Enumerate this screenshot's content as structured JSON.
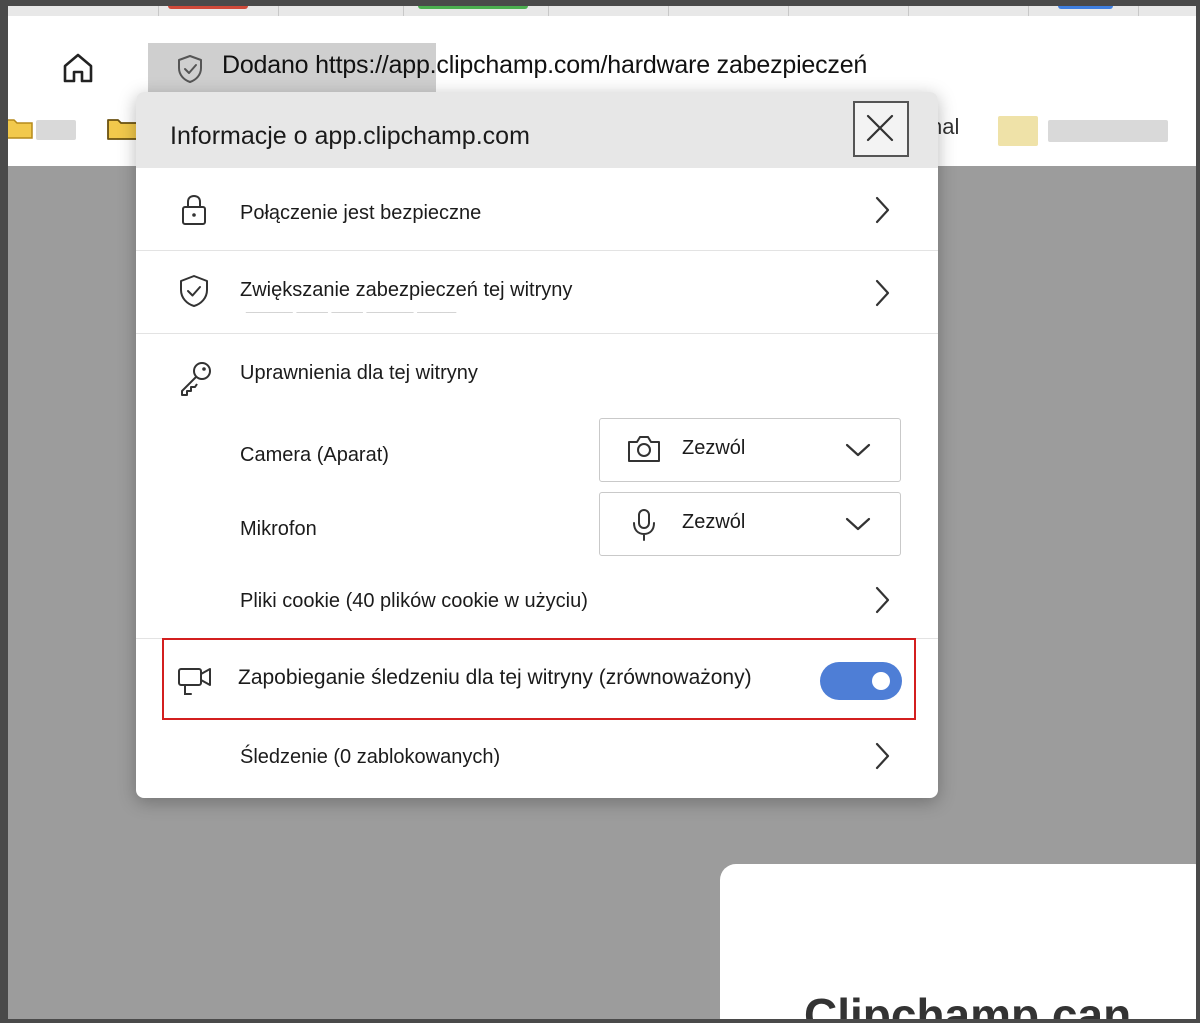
{
  "toolbar": {
    "address_text": "Dodano https://app.clipchamp.com/hardware zabezpieczeń"
  },
  "bookmarks": {
    "partial_label": "nal"
  },
  "flyout": {
    "title": "Informacje o app.clipchamp.com",
    "connection": {
      "label": "Połączenie jest bezpieczne"
    },
    "enhance_security": {
      "label": "Zwiększanie zabezpieczeń tej witryny"
    },
    "permissions": {
      "label": "Uprawnienia dla tej witryny",
      "camera": {
        "label": "Camera (Aparat)",
        "value": "Zezwól"
      },
      "microphone": {
        "label": "Mikrofon",
        "value": "Zezwól"
      },
      "cookies": {
        "label": "Pliki cookie (40 plików cookie w użyciu)"
      }
    },
    "tracking_prevention": {
      "label": "Zapobieganie śledzeniu dla tej witryny (zrównoważony)",
      "enabled": true
    },
    "trackers": {
      "label": "Śledzenie (0 zablokowanych)"
    }
  },
  "page": {
    "card_title": "Clipchamp can"
  },
  "colors": {
    "toggle_on": "#4e7ed6",
    "highlight_border": "#d31f1f",
    "page_background": "#9c9c9c"
  },
  "icons": [
    "home-icon",
    "shield-check-icon",
    "folder-icon",
    "close-icon",
    "lock-icon",
    "key-icon",
    "camera-icon",
    "microphone-icon",
    "chevron-right-icon",
    "chevron-down-icon",
    "tracking-prevention-icon"
  ]
}
